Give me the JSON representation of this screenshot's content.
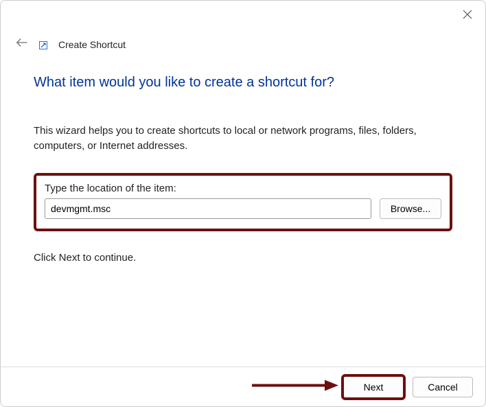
{
  "header": {
    "title": "Create Shortcut"
  },
  "content": {
    "question": "What item would you like to create a shortcut for?",
    "description": "This wizard helps you to create shortcuts to local or network programs, files, folders, computers, or Internet addresses.",
    "location_label": "Type the location of the item:",
    "location_value": "devmgmt.msc",
    "browse_label": "Browse...",
    "continue_text": "Click Next to continue."
  },
  "footer": {
    "next_label": "Next",
    "cancel_label": "Cancel"
  }
}
